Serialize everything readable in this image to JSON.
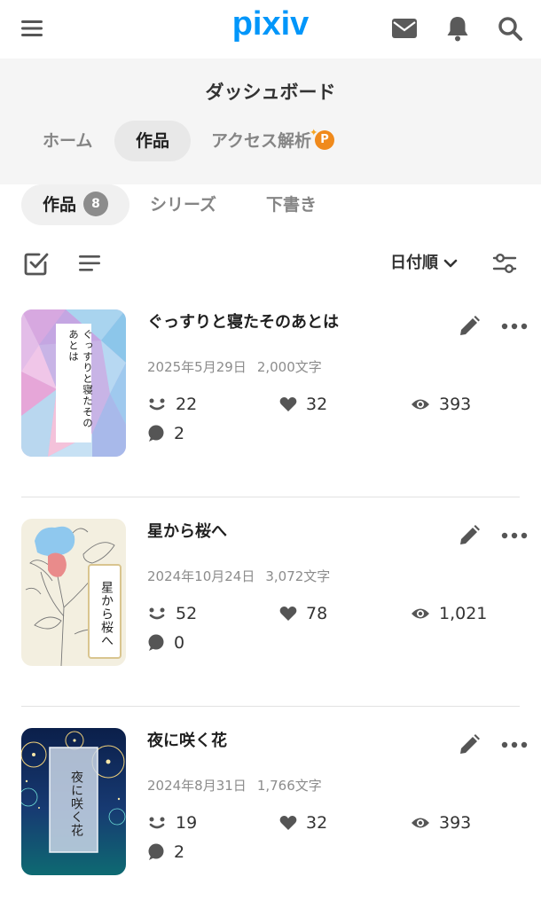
{
  "header": {
    "logo": "pixiv",
    "menu_icon": "hamburger-menu-icon",
    "mail_icon": "mail-icon",
    "bell_icon": "bell-icon",
    "search_icon": "search-icon",
    "brand_color": "#0096fa"
  },
  "dashboard": {
    "title": "ダッシュボード",
    "tabs": [
      {
        "label": "ホーム",
        "active": false
      },
      {
        "label": "作品",
        "active": true
      },
      {
        "label": "アクセス解析",
        "active": false,
        "badge": "P"
      }
    ]
  },
  "subtabs": [
    {
      "label": "作品",
      "count": "8",
      "active": true
    },
    {
      "label": "シリーズ",
      "active": false
    },
    {
      "label": "下書き",
      "active": false
    }
  ],
  "toolbar": {
    "select_icon": "checkbox-select-icon",
    "list_icon": "list-view-icon",
    "sort_label": "日付順",
    "filter_icon": "filter-sliders-icon"
  },
  "works": [
    {
      "title": "ぐっすりと寝たそのあとは",
      "cover_text": "ぐっすりと寝たそのあとは",
      "date": "2025年5月29日",
      "length": "2,000文字",
      "reactions": "22",
      "likes": "32",
      "views": "393",
      "comments": "2"
    },
    {
      "title": "星から桜へ",
      "cover_text": "星から桜へ",
      "date": "2024年10月24日",
      "length": "3,072文字",
      "reactions": "52",
      "likes": "78",
      "views": "1,021",
      "comments": "0"
    },
    {
      "title": "夜に咲く花",
      "cover_text": "夜に咲く花",
      "date": "2024年8月31日",
      "length": "1,766文字",
      "reactions": "19",
      "likes": "32",
      "views": "393",
      "comments": "2"
    }
  ]
}
